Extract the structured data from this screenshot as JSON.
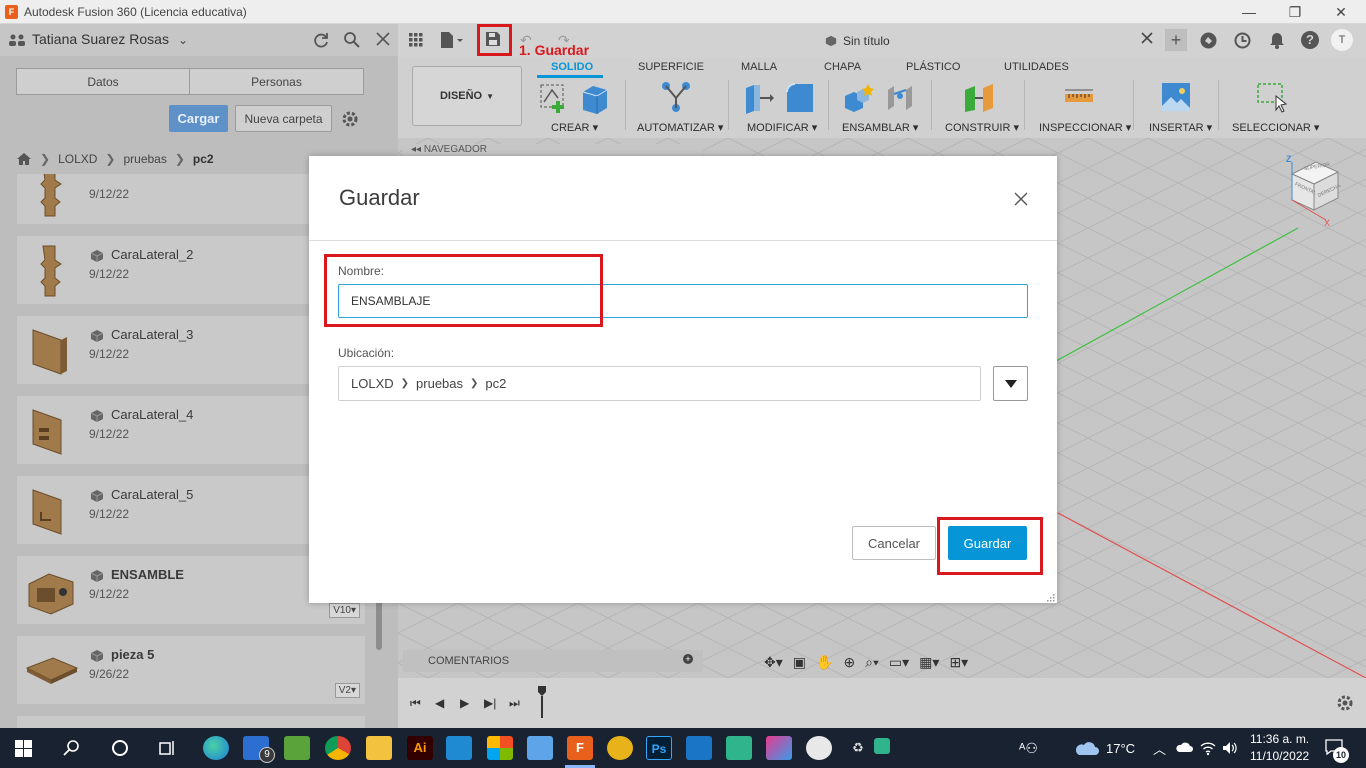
{
  "window": {
    "title": "Autodesk Fusion 360 (Licencia educativa)"
  },
  "data_panel": {
    "user_name": "Tatiana Suarez Rosas",
    "tabs": [
      "Datos",
      "Personas"
    ],
    "upload_label": "Cargar",
    "new_folder_label": "Nueva carpeta",
    "breadcrumb": [
      "LOLXD",
      "pruebas",
      "pc2"
    ],
    "files": [
      {
        "name": "",
        "date": "9/12/22"
      },
      {
        "name": "CaraLateral_2",
        "date": "9/12/22"
      },
      {
        "name": "CaraLateral_3",
        "date": "9/12/22"
      },
      {
        "name": "CaraLateral_4",
        "date": "9/12/22"
      },
      {
        "name": "CaraLateral_5",
        "date": "9/12/22"
      },
      {
        "name": "ENSAMBLE",
        "date": "9/12/22",
        "version": "V10▾"
      },
      {
        "name": "pieza 5",
        "date": "9/26/22",
        "version": "V2▾"
      }
    ]
  },
  "document": {
    "tab_title": "Sin título"
  },
  "annotation": {
    "step_label": "1. Guardar"
  },
  "ribbon": {
    "workspace": "DISEÑO",
    "tabs": [
      "SOLIDO",
      "SUPERFICIE",
      "MALLA",
      "CHAPA",
      "PLÁSTICO",
      "UTILIDADES"
    ],
    "active_tab": "SOLIDO",
    "groups": [
      "CREAR",
      "AUTOMATIZAR",
      "MODIFICAR",
      "ENSAMBLAR",
      "CONSTRUIR",
      "INSPECCIONAR",
      "INSERTAR",
      "SELECCIONAR"
    ]
  },
  "browser": {
    "navigator_label": "NAVEGADOR",
    "comments_label": "COMENTARIOS"
  },
  "viewcube": {
    "axis_z": "Z",
    "axis_x": "X",
    "face_top": "SUPERIOR",
    "face_front": "FRONTAL",
    "face_right": "DERECHA"
  },
  "user_initial": "T",
  "save_dialog": {
    "title": "Guardar",
    "name_label": "Nombre:",
    "name_value": "ENSAMBLAJE",
    "location_label": "Ubicación:",
    "location_path": [
      "LOLXD",
      "pruebas",
      "pc2"
    ],
    "cancel_label": "Cancelar",
    "save_label": "Guardar"
  },
  "taskbar": {
    "mail_count": "9",
    "temperature": "17°C",
    "time": "11:36 a. m.",
    "date": "11/10/2022",
    "notification_count": "10"
  },
  "colors": {
    "accent": "#0696d7",
    "highlight": "#d9181d",
    "upload_button": "#5e91c7",
    "taskbar": "#182230"
  }
}
